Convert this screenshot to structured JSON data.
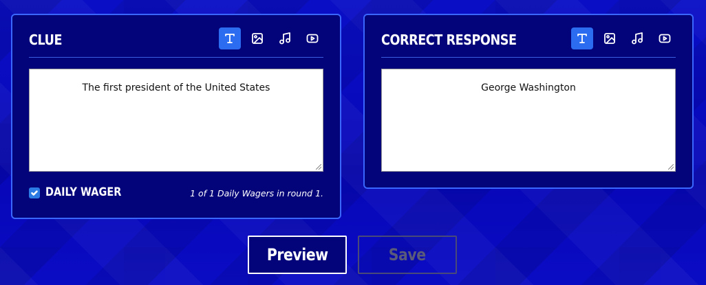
{
  "clue_panel": {
    "title": "CLUE",
    "text": "The first president of the United States",
    "media_icons": [
      "text-icon",
      "image-icon",
      "music-icon",
      "video-icon"
    ],
    "active_media": "text-icon",
    "daily_wager": {
      "checked": true,
      "label": "DAILY WAGER",
      "count_text": "1 of 1 Daily Wagers in round 1."
    }
  },
  "response_panel": {
    "title": "CORRECT RESPONSE",
    "text": "George Washington",
    "media_icons": [
      "text-icon",
      "image-icon",
      "music-icon",
      "video-icon"
    ],
    "active_media": "text-icon"
  },
  "actions": {
    "preview_label": "Preview",
    "save_label": "Save"
  },
  "colors": {
    "background": "#0a0cc4",
    "panel": "#03047a",
    "panel_border": "#3a68ff",
    "active_icon": "#2c6cf0",
    "checkbox": "#2c7be5"
  }
}
